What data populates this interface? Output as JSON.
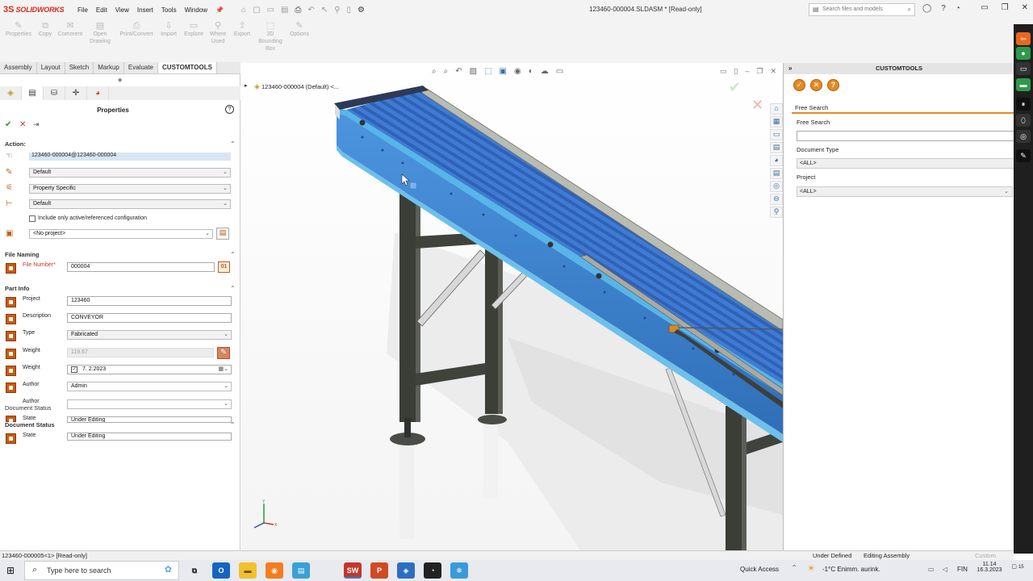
{
  "app": {
    "logo_mark": "3S",
    "logo_text": "SOLIDWORKS",
    "doc_title": "123460-000004.SLDASM * [Read-only]",
    "menu": [
      "File",
      "Edit",
      "View",
      "Insert",
      "Tools",
      "Window"
    ],
    "search_placeholder": "Search files and models"
  },
  "commands": [
    "Properties",
    "Copy",
    "Comment",
    "Open Drawing",
    "Print/Convert",
    "Import",
    "Explore",
    "Where Used",
    "Export",
    "3D Bounding Box",
    "Options"
  ],
  "tabs": [
    "Assembly",
    "Layout",
    "Sketch",
    "Markup",
    "Evaluate",
    "CUSTOMTOOLS"
  ],
  "active_tab": "CUSTOMTOOLS",
  "properties": {
    "title": "Properties",
    "help": "?",
    "action_header": "Action:",
    "config_ref": "123460-000004@123460-000004",
    "select1": "Default",
    "select2": "Property Specific",
    "select3": "Default",
    "checkbox_label": "Include only active/referenced configuration",
    "project_select": "<No project>",
    "file_naming_header": "File Naming",
    "file_number_label": "File Number*",
    "file_number_value": "000004",
    "part_info_header": "Part Info",
    "fields": [
      {
        "label": "Project",
        "value": "123460"
      },
      {
        "label": "Description",
        "value": "CONVEYOR"
      },
      {
        "label": "Type",
        "value": "Fabricated"
      },
      {
        "label": "Weight",
        "value": "119.67"
      },
      {
        "label": "Weight",
        "value": "7.  2.2023"
      },
      {
        "label": "Author",
        "value": "Admin"
      }
    ],
    "ghost_author_label": "Author",
    "doc_status_header": "Document Status",
    "ghost_state_label": "State",
    "ghost_state_value": "Under Editing",
    "state_label": "State",
    "state_value": "Under Editing"
  },
  "graphics": {
    "tree_label": "123460-000004 (Default) <..."
  },
  "customtools": {
    "header": "CUSTOMTOOLS",
    "tab_label": "Free Search",
    "free_search_label": "Free Search",
    "free_search_value": "",
    "doc_type_label": "Document Type",
    "doc_type_value": "<ALL>",
    "project_label": "Project",
    "project_value": "<ALL>"
  },
  "status": {
    "left": "123460-000005<1> [Read-only]",
    "under_defined": "Under Defined",
    "editing": "Editing Assembly",
    "custom": "Custom"
  },
  "taskbar": {
    "search_text": "Type here to search",
    "quick_access": "Quick Access",
    "weather": "-1°C  Enimm. aurink.",
    "lang": "FIN",
    "time": "11.14",
    "date": "16.3.2023",
    "notif_count": "15"
  },
  "colors": {
    "accent_orange": "#e8891f",
    "conveyor_blue": "#3a7ecf",
    "frame_dark": "#3a3f36",
    "solidworks_red": "#d52b1e"
  }
}
